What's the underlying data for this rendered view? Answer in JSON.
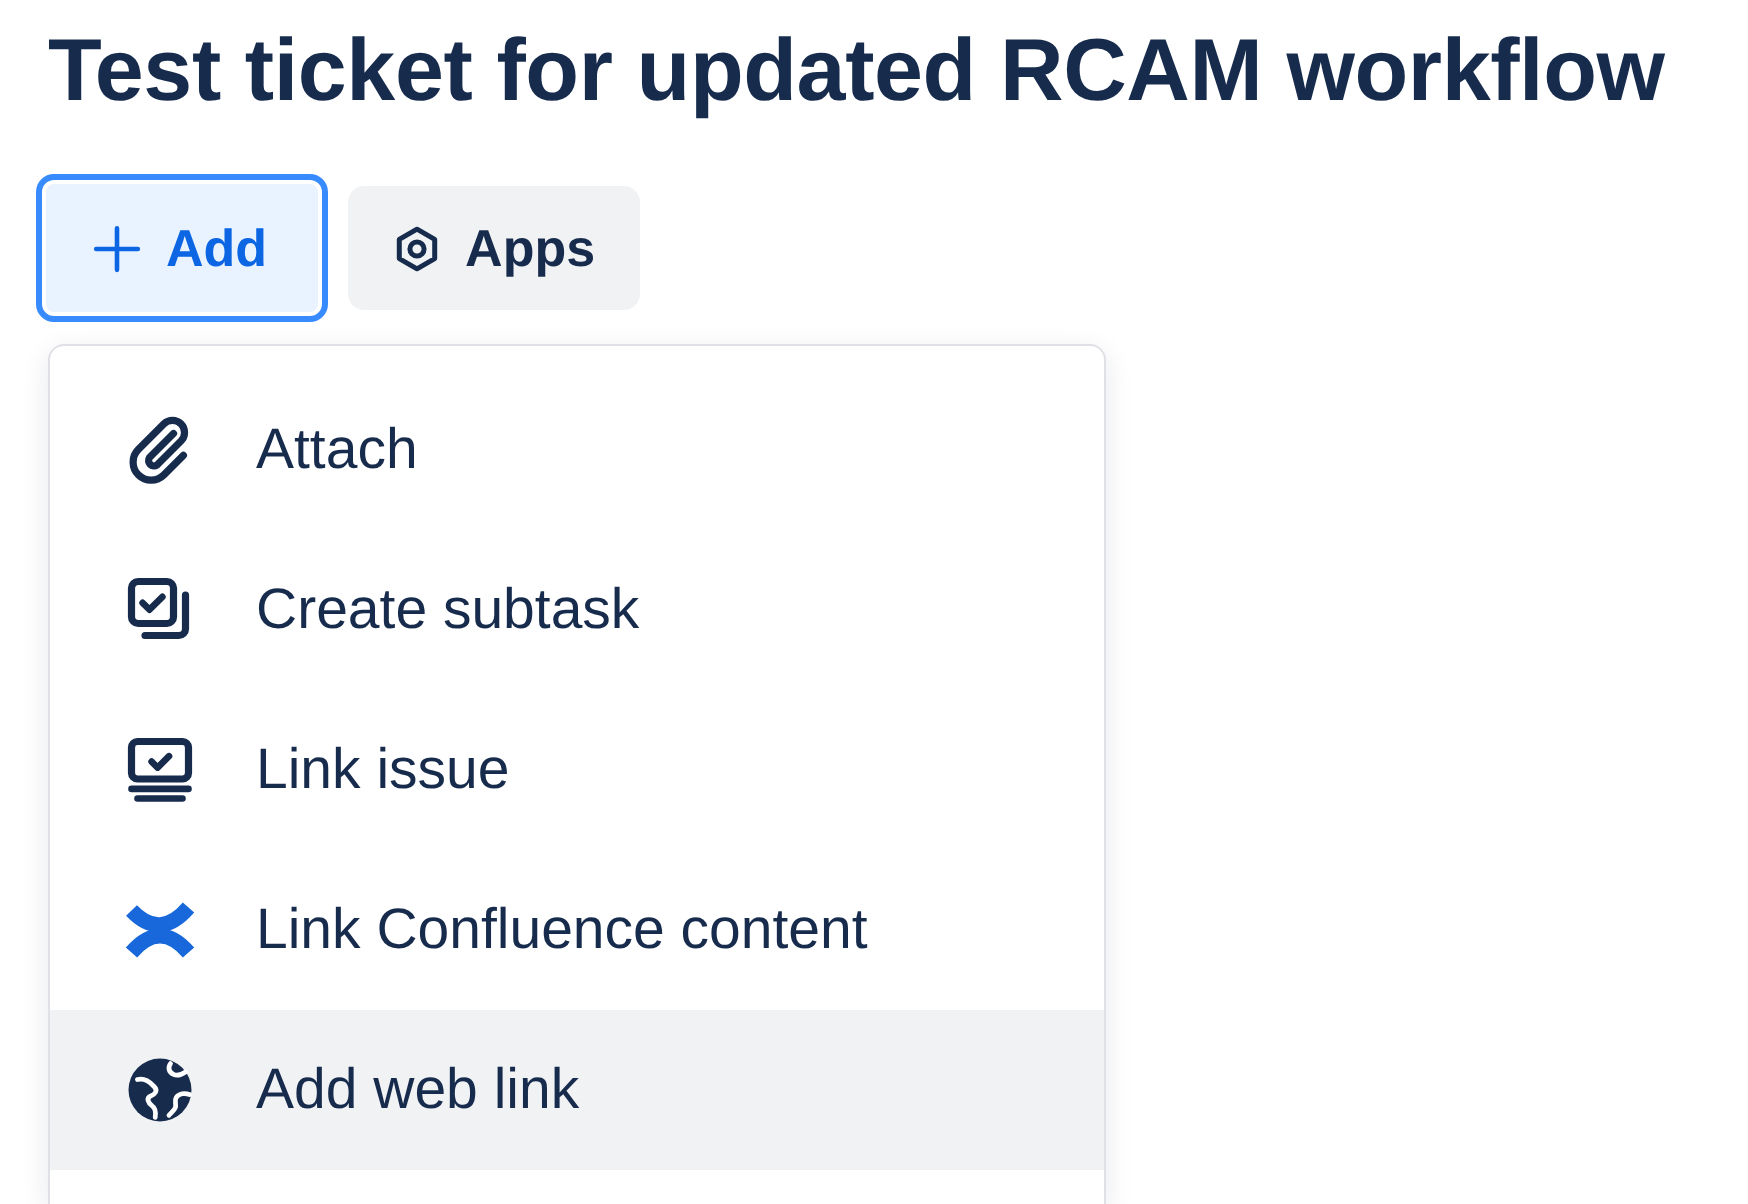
{
  "title": "Test ticket for updated RCAM workflow",
  "toolbar": [
    {
      "label": "Add",
      "expanded": true
    },
    {
      "label": "Apps",
      "expanded": false
    }
  ],
  "menu": {
    "items": [
      {
        "label": "Attach",
        "highlighted": false
      },
      {
        "label": "Create subtask",
        "highlighted": false
      },
      {
        "label": "Link issue",
        "highlighted": false
      },
      {
        "label": "Link Confluence content",
        "highlighted": false
      },
      {
        "label": "Add web link",
        "highlighted": true
      }
    ]
  }
}
